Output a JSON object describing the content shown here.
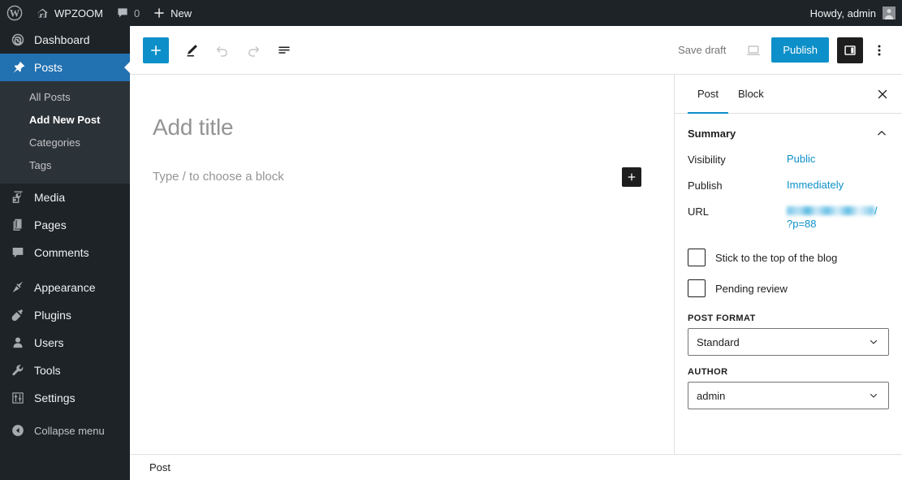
{
  "adminbar": {
    "wp_logo_icon": "wordpress-logo-icon",
    "site_home_icon": "home-icon",
    "site_name": "WPZOOM",
    "comments_icon": "comment-bubble-icon",
    "comments_count": "0",
    "new_icon": "plus-icon",
    "new_label": "New",
    "howdy": "Howdy, admin",
    "avatar_icon": "user-avatar-icon"
  },
  "sidebar": {
    "items": [
      {
        "label": "Dashboard",
        "icon": "dashboard-gauge-icon",
        "active": false
      },
      {
        "label": "Posts",
        "icon": "pin-icon",
        "active": true
      },
      {
        "label": "Media",
        "icon": "media-icon",
        "active": false
      },
      {
        "label": "Pages",
        "icon": "pages-icon",
        "active": false
      },
      {
        "label": "Comments",
        "icon": "comment-bubble-icon",
        "active": false
      },
      {
        "label": "Appearance",
        "icon": "paintbrush-icon",
        "active": false
      },
      {
        "label": "Plugins",
        "icon": "plug-icon",
        "active": false
      },
      {
        "label": "Users",
        "icon": "user-icon",
        "active": false
      },
      {
        "label": "Tools",
        "icon": "wrench-icon",
        "active": false
      },
      {
        "label": "Settings",
        "icon": "sliders-icon",
        "active": false
      }
    ],
    "submenu": [
      {
        "label": "All Posts",
        "current": false
      },
      {
        "label": "Add New Post",
        "current": true
      },
      {
        "label": "Categories",
        "current": false
      },
      {
        "label": "Tags",
        "current": false
      }
    ],
    "collapse": {
      "label": "Collapse menu",
      "icon": "collapse-arrow-icon"
    }
  },
  "toolbar": {
    "inserter_icon": "plus-icon",
    "inserter_label": "Toggle block inserter",
    "tools_icon": "pencil-edit-icon",
    "undo_icon": "undo-arrow-icon",
    "redo_icon": "redo-arrow-icon",
    "list_view_icon": "document-overview-icon",
    "save_draft_label": "Save draft",
    "preview_icon": "desktop-preview-icon",
    "publish_label": "Publish",
    "sidebar_toggle_icon": "settings-panel-icon",
    "more_options_icon": "three-dots-vertical-icon"
  },
  "canvas": {
    "title_placeholder": "Add title",
    "block_placeholder": "Type / to choose a block",
    "appender_icon": "plus-icon"
  },
  "settings_panel": {
    "tabs": [
      {
        "label": "Post",
        "active": true
      },
      {
        "label": "Block",
        "active": false
      }
    ],
    "close_icon": "close-x-icon",
    "summary": {
      "title": "Summary",
      "collapse_icon": "chevron-up-icon",
      "rows": [
        {
          "key": "Visibility",
          "value": "Public"
        },
        {
          "key": "Publish",
          "value": "Immediately"
        }
      ],
      "url_key": "URL",
      "url_redacted": true,
      "url_suffix": "/",
      "url_query": "?p=88"
    },
    "checkboxes": [
      {
        "label": "Stick to the top of the blog",
        "checked": false
      },
      {
        "label": "Pending review",
        "checked": false
      }
    ],
    "post_format": {
      "label": "POST FORMAT",
      "value": "Standard",
      "chevron_icon": "chevron-down-icon"
    },
    "author": {
      "label": "AUTHOR",
      "value": "admin",
      "chevron_icon": "chevron-down-icon"
    }
  },
  "footer": {
    "breadcrumb": "Post"
  },
  "colors": {
    "admin_dark": "#1d2327",
    "admin_submenu": "#2c3338",
    "admin_active_blue": "#2271b1",
    "accent_blue": "#0d90c9",
    "muted_text": "#757575",
    "placeholder_text": "#949494",
    "border": "#e0e0e0"
  }
}
